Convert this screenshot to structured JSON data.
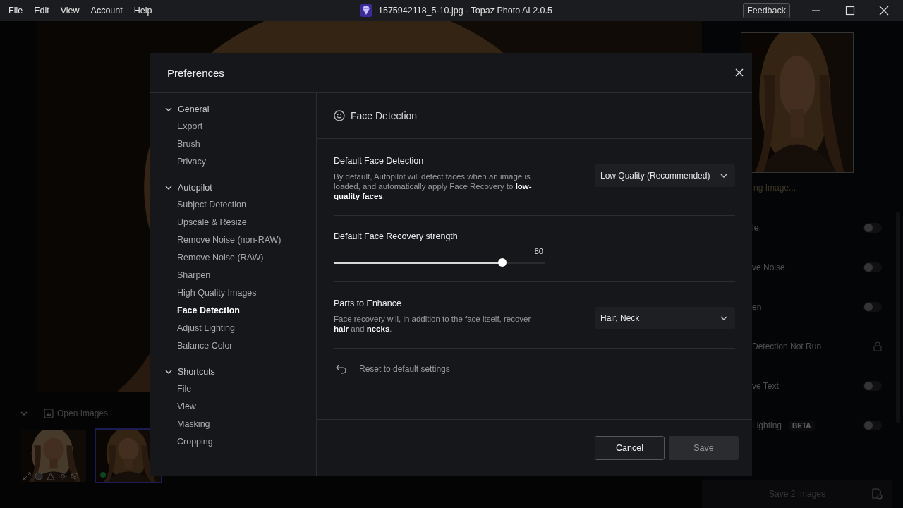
{
  "menu": [
    "File",
    "Edit",
    "View",
    "Account",
    "Help"
  ],
  "window": {
    "title": "1575942118_5-10.jpg - Topaz Photo AI 2.0.5",
    "feedback": "Feedback"
  },
  "background": {
    "preview_caption": "ng Image...",
    "filters": [
      {
        "label": "le",
        "kind": "toggle",
        "on": false
      },
      {
        "label": "ve Noise",
        "kind": "toggle",
        "on": false
      },
      {
        "label": "en",
        "kind": "toggle",
        "on": false
      },
      {
        "label": "Detection Not Run",
        "kind": "locked"
      },
      {
        "label": "ve Text",
        "kind": "toggle",
        "on": false
      },
      {
        "label": "Lighting",
        "badge": "BETA",
        "kind": "toggle",
        "on": false
      }
    ],
    "save_button": "Save 2 Images",
    "open_images": "Open Images",
    "thumbnails": [
      {
        "selected": false
      },
      {
        "selected": true
      }
    ]
  },
  "dialog": {
    "title": "Preferences",
    "nav": [
      {
        "label": "General",
        "expanded": true,
        "children": [
          {
            "label": "Export",
            "selected": false
          },
          {
            "label": "Brush",
            "selected": false
          },
          {
            "label": "Privacy",
            "selected": false
          }
        ]
      },
      {
        "label": "Autopilot",
        "expanded": true,
        "children": [
          {
            "label": "Subject Detection",
            "selected": false
          },
          {
            "label": "Upscale & Resize",
            "selected": false
          },
          {
            "label": "Remove Noise (non-RAW)",
            "selected": false
          },
          {
            "label": "Remove Noise (RAW)",
            "selected": false
          },
          {
            "label": "Sharpen",
            "selected": false
          },
          {
            "label": "High Quality Images",
            "selected": false
          },
          {
            "label": "Face Detection",
            "selected": true
          },
          {
            "label": "Adjust Lighting",
            "selected": false
          },
          {
            "label": "Balance Color",
            "selected": false
          }
        ]
      },
      {
        "label": "Shortcuts",
        "expanded": true,
        "children": [
          {
            "label": "File",
            "selected": false
          },
          {
            "label": "View",
            "selected": false
          },
          {
            "label": "Masking",
            "selected": false
          },
          {
            "label": "Cropping",
            "selected": false
          }
        ]
      }
    ],
    "section_title": "Face Detection",
    "settings": [
      {
        "kind": "select",
        "title": "Default Face Detection",
        "description": "By default, Autopilot will detect faces when an image is loaded, and automatically apply Face Recovery to **low-quality faces**.",
        "value": "Low Quality (Recommended)"
      },
      {
        "kind": "slider",
        "title": "Default Face Recovery strength",
        "reading": "80",
        "level": 0.8
      },
      {
        "kind": "select",
        "title": "Parts to Enhance",
        "description": "Face recovery will, in addition to the face itself, recover **hair** and **necks**.",
        "value": "Hair, Neck"
      }
    ],
    "reset": "Reset to default settings",
    "buttons": [
      {
        "label": "Cancel",
        "kind": "secondary",
        "disabled": false
      },
      {
        "label": "Save",
        "kind": "primary",
        "disabled": true
      }
    ]
  }
}
